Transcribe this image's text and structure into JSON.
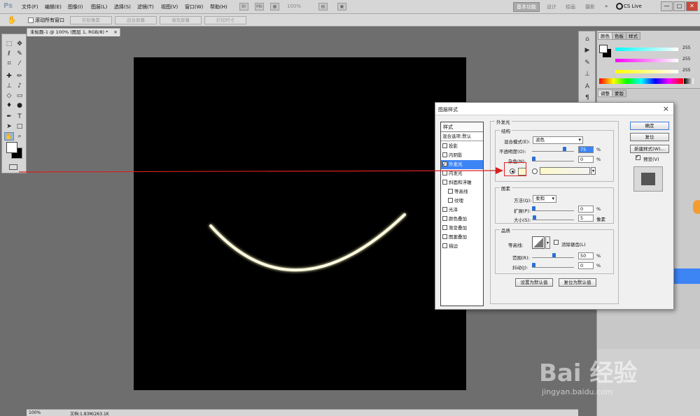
{
  "app": {
    "logo": "Ps",
    "menus": [
      "文件(F)",
      "编辑(E)",
      "图像(I)",
      "图层(L)",
      "选择(S)",
      "滤镜(T)",
      "视图(V)",
      "窗口(W)",
      "帮助(H)"
    ],
    "zoom_display": "100%",
    "workspace_active": "基本功能",
    "workspace_items": [
      "设计",
      "绘画",
      "摄影"
    ],
    "cs_live": "CS Live",
    "window_controls": [
      "—",
      "□",
      "✕"
    ]
  },
  "options_bar": {
    "scroll_all_label": "滚动所有窗口",
    "buttons": [
      "实际像素",
      "适合屏幕",
      "填充屏幕",
      "打印尺寸"
    ]
  },
  "document": {
    "tab_title": "未标题-1 @ 100% (图层 1, RGB/8) *",
    "status_zoom": "100%",
    "status_doc": "文档:1.83M/263.1K"
  },
  "panels": {
    "color_tabs": [
      "颜色",
      "色板",
      "样式"
    ],
    "rgb_values": [
      "255",
      "255",
      "255"
    ],
    "adjust_tabs": [
      "调整",
      "蒙版"
    ]
  },
  "dialog": {
    "title": "图层样式",
    "style_header": "样式",
    "style_default": "混合选项:默认",
    "styles": [
      {
        "label": "投影",
        "checked": false,
        "indent": false
      },
      {
        "label": "内阴影",
        "checked": false,
        "indent": false
      },
      {
        "label": "外发光",
        "checked": true,
        "indent": false,
        "selected": true
      },
      {
        "label": "内发光",
        "checked": false,
        "indent": false
      },
      {
        "label": "斜面和浮雕",
        "checked": false,
        "indent": false
      },
      {
        "label": "等高线",
        "checked": false,
        "indent": true
      },
      {
        "label": "纹理",
        "checked": false,
        "indent": true
      },
      {
        "label": "光泽",
        "checked": false,
        "indent": false
      },
      {
        "label": "颜色叠加",
        "checked": false,
        "indent": false
      },
      {
        "label": "渐变叠加",
        "checked": false,
        "indent": false
      },
      {
        "label": "图案叠加",
        "checked": false,
        "indent": false
      },
      {
        "label": "描边",
        "checked": false,
        "indent": false
      }
    ],
    "outer_glow": "外发光",
    "structure": {
      "title": "结构",
      "blend_mode_label": "混合模式(E):",
      "blend_mode_value": "滤色",
      "opacity_label": "不透明度(O):",
      "opacity_value": "75",
      "opacity_percent": 75,
      "noise_label": "杂色(N):",
      "noise_value": "0",
      "noise_percent": 0,
      "unit_percent": "%"
    },
    "elements": {
      "title": "图素",
      "method_label": "方法(Q):",
      "method_value": "柔和",
      "spread_label": "扩展(P):",
      "spread_value": "0",
      "spread_percent": 0,
      "size_label": "大小(S):",
      "size_value": "5",
      "size_unit": "像素"
    },
    "quality": {
      "title": "品质",
      "contour_label": "等高线:",
      "antialias_label": "消除锯齿(L)",
      "range_label": "范围(R):",
      "range_value": "50",
      "range_percent": 50,
      "jitter_label": "抖动(J):",
      "jitter_value": "0",
      "jitter_percent": 0
    },
    "set_default": "设置为默认值",
    "reset_default": "复位为默认值",
    "ok": "确定",
    "reset": "复位",
    "new_style": "新建样式(W)...",
    "preview_label": "预览(V)",
    "glow_color": "#fdf9c9"
  },
  "watermark": {
    "text": "Bai 经验",
    "url": "jingyan.baidu.com"
  }
}
